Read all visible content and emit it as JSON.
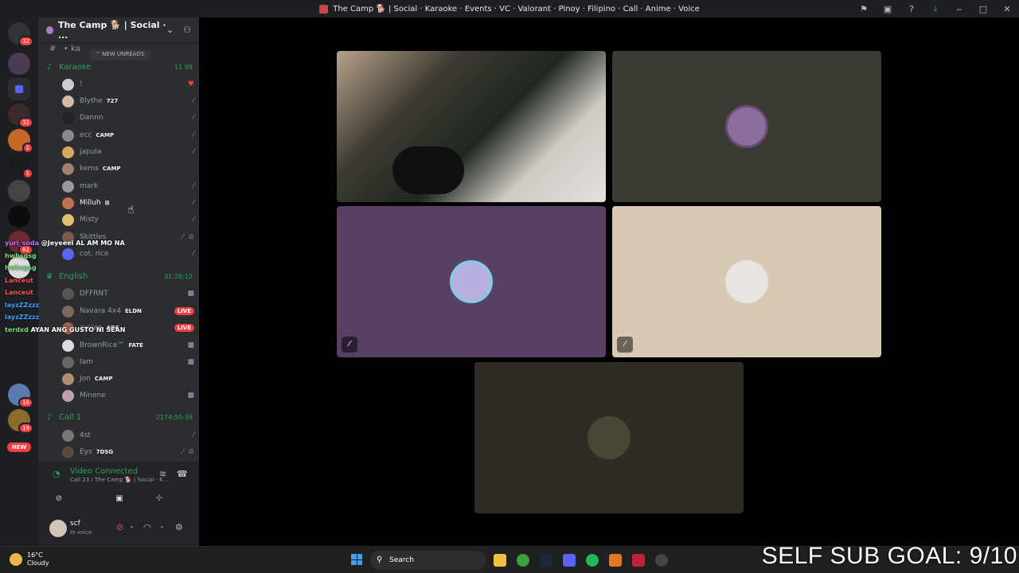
{
  "window": {
    "title": "The Camp 🐕 | Social · Karaoke · Events · VC · Valorant · Pinoy · Filipino · Call · Anime · Voice",
    "controls": [
      "‒",
      "□",
      "✕"
    ]
  },
  "server_rail": {
    "badges": [
      "32",
      "32",
      "1",
      "1",
      "62",
      "16",
      "19"
    ],
    "new_label": "NEW"
  },
  "server_header": {
    "name": "The Camp 🐕 | Social · ...",
    "new_unreads": "NEW UNREADS",
    "peek_channel": "ka"
  },
  "channels": [
    {
      "name": "Karaoke",
      "meta": "11  99",
      "members": [
        {
          "name": "!",
          "tag": ""
        },
        {
          "name": "Blythe",
          "tag": "727"
        },
        {
          "name": "Dannn",
          "tag": ""
        },
        {
          "name": "ecc",
          "tag": "CAMP"
        },
        {
          "name": "japula",
          "tag": ""
        },
        {
          "name": "kems",
          "tag": "CAMP"
        },
        {
          "name": "mark",
          "tag": ""
        },
        {
          "name": "Milluh",
          "tag": ""
        },
        {
          "name": "Misty",
          "tag": ""
        },
        {
          "name": "Skittles",
          "tag": ""
        },
        {
          "name": "cot. rice",
          "tag": ""
        }
      ]
    },
    {
      "name": "English",
      "meta": "31:28:12",
      "members": [
        {
          "name": "DFFRNT",
          "tag": ""
        },
        {
          "name": "Navara 4x4",
          "tag": "ELDN",
          "live": "LIVE"
        },
        {
          "name": "zycien",
          "tag": "ARC",
          "live": "LIVE"
        },
        {
          "name": "BrownRice™",
          "tag": "FATE"
        },
        {
          "name": "Iam",
          "tag": ""
        },
        {
          "name": "Jon",
          "tag": "CAMP"
        },
        {
          "name": "Minene",
          "tag": ""
        }
      ]
    },
    {
      "name": "Call 1",
      "meta": "2174:50:39",
      "members": [
        {
          "name": "4st",
          "tag": ""
        },
        {
          "name": "Eys",
          "tag": "7DSG"
        }
      ]
    }
  ],
  "chat_overlay": [
    {
      "user": "yuri_soda",
      "msg": "@Jeyeeel AL AM MO NA"
    },
    {
      "user": "hwhsgsg",
      "msg": ""
    },
    {
      "user": "hwhsgsg",
      "msg": ""
    },
    {
      "user": "Lanceut",
      "msg": ""
    },
    {
      "user": "Lanceut",
      "msg": ""
    },
    {
      "user": "layzZZzzz",
      "msg": ""
    },
    {
      "user": "layzZZzzz",
      "msg": ""
    },
    {
      "user": "terdxd",
      "msg": "AYAN ANG GUSTO NI SEAN"
    }
  ],
  "voice_panel": {
    "status": "Video Connected",
    "location": "Call 23 / The Camp 🐕 | Social - K..."
  },
  "user_panel": {
    "username": "scf",
    "status": "In voice"
  },
  "taskbar": {
    "temperature": "16°C",
    "condition": "Cloudy",
    "search_placeholder": "Search"
  },
  "overlay_text": "SELF SUB GOAL: 9/10",
  "colors": {
    "accent_green": "#23a559",
    "live_red": "#f23f42",
    "tile_olive": "#3a3b31",
    "tile_purple": "#5a3f65",
    "tile_beige": "#d8c8b4",
    "tile_dark": "#2f2c26"
  }
}
